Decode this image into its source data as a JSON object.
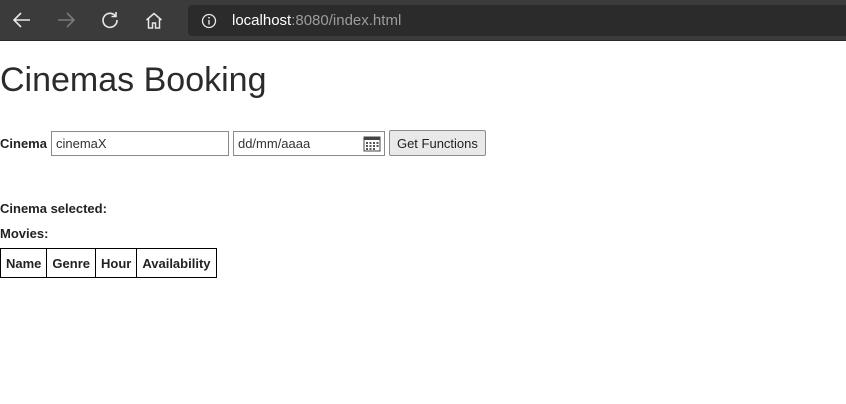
{
  "browser": {
    "url_host": "localhost",
    "url_rest": ":8080/index.html",
    "icons": [
      "back-arrow-icon",
      "forward-arrow-icon",
      "refresh-icon",
      "home-icon",
      "info-icon"
    ]
  },
  "page": {
    "title": "Cinemas Booking",
    "cinema_label": "Cinema",
    "cinema_value": "cinemaX",
    "date_placeholder": "dd/mm/aaaa",
    "get_button": "Get Functions",
    "cinema_selected_label": "Cinema selected:",
    "movies_label": "Movies:",
    "table_headers": [
      "Name",
      "Genre",
      "Hour",
      "Availability"
    ]
  }
}
